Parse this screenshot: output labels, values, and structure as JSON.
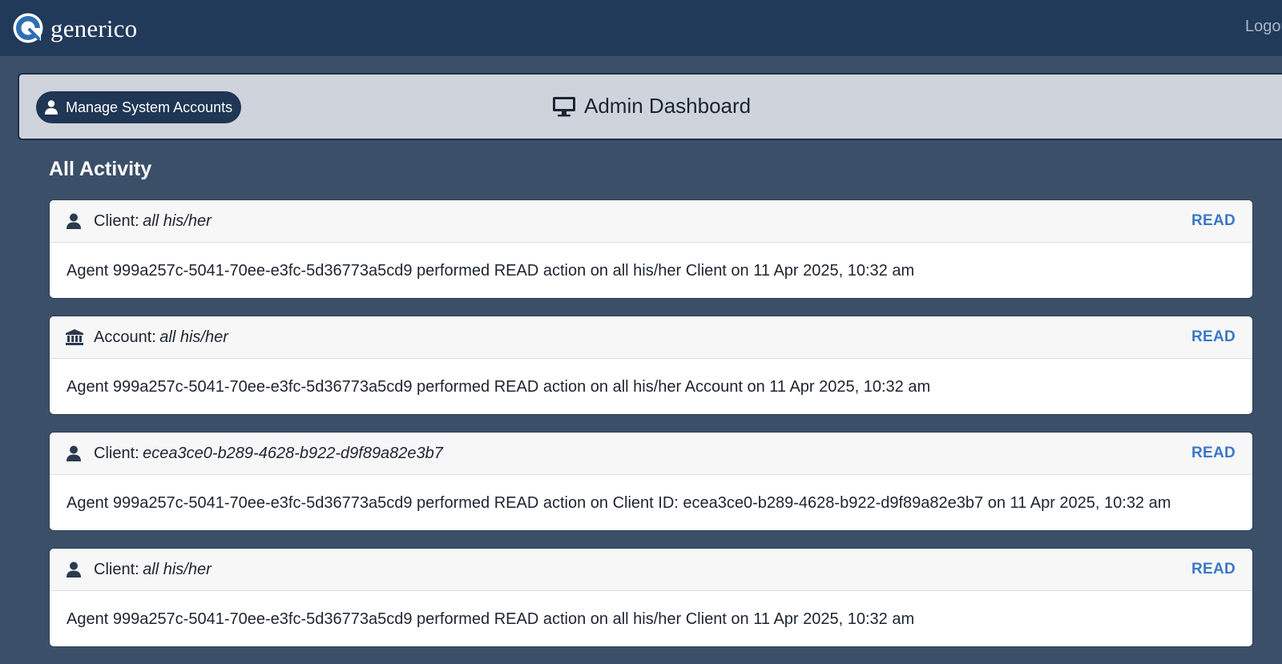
{
  "navbar": {
    "brand_name": "generico",
    "logout_label": "Logout"
  },
  "dashboard": {
    "manage_button_label": "Manage System Accounts",
    "title": "Admin Dashboard"
  },
  "activity": {
    "section_title": "All Activity",
    "items": [
      {
        "icon": "user-icon",
        "type_label": "Client:",
        "target": "all his/her",
        "action": "READ",
        "message": "Agent 999a257c-5041-70ee-e3fc-5d36773a5cd9 performed READ action on all his/her Client on 11 Apr 2025, 10:32 am"
      },
      {
        "icon": "bank-icon",
        "type_label": "Account:",
        "target": "all his/her",
        "action": "READ",
        "message": "Agent 999a257c-5041-70ee-e3fc-5d36773a5cd9 performed READ action on all his/her Account on 11 Apr 2025, 10:32 am"
      },
      {
        "icon": "user-icon",
        "type_label": "Client:",
        "target": "ecea3ce0-b289-4628-b922-d9f89a82e3b7",
        "action": "READ",
        "message": "Agent 999a257c-5041-70ee-e3fc-5d36773a5cd9 performed READ action on Client ID: ecea3ce0-b289-4628-b922-d9f89a82e3b7 on 11 Apr 2025, 10:32 am"
      },
      {
        "icon": "user-icon",
        "type_label": "Client:",
        "target": "all his/her",
        "action": "READ",
        "message": "Agent 999a257c-5041-70ee-e3fc-5d36773a5cd9 performed READ action on all his/her Client on 11 Apr 2025, 10:32 am"
      }
    ]
  },
  "colors": {
    "navbar_bg": "#223a5a",
    "page_bg": "#3b5068",
    "panel_bg": "#cfd4dc",
    "action_accent": "#3a79c5"
  }
}
